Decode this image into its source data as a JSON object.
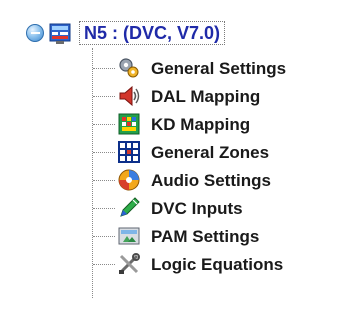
{
  "root": {
    "label": "N5 : (DVC, V7.0)",
    "expander_icon": "collapse-minus-icon",
    "icon": "panel-node-icon"
  },
  "items": [
    {
      "label": "General Settings",
      "icon": "settings-gears-icon"
    },
    {
      "label": "DAL Mapping",
      "icon": "speaker-map-icon"
    },
    {
      "label": "KD Mapping",
      "icon": "keypad-map-icon"
    },
    {
      "label": "General Zones",
      "icon": "zones-grid-icon"
    },
    {
      "label": "Audio Settings",
      "icon": "audio-settings-icon"
    },
    {
      "label": "DVC Inputs",
      "icon": "inputs-pen-icon"
    },
    {
      "label": "PAM Settings",
      "icon": "pam-screen-icon"
    },
    {
      "label": "Logic Equations",
      "icon": "tools-icon"
    }
  ],
  "colors": {
    "root_text": "#1f2aa8",
    "item_text": "#1a1a1a"
  }
}
